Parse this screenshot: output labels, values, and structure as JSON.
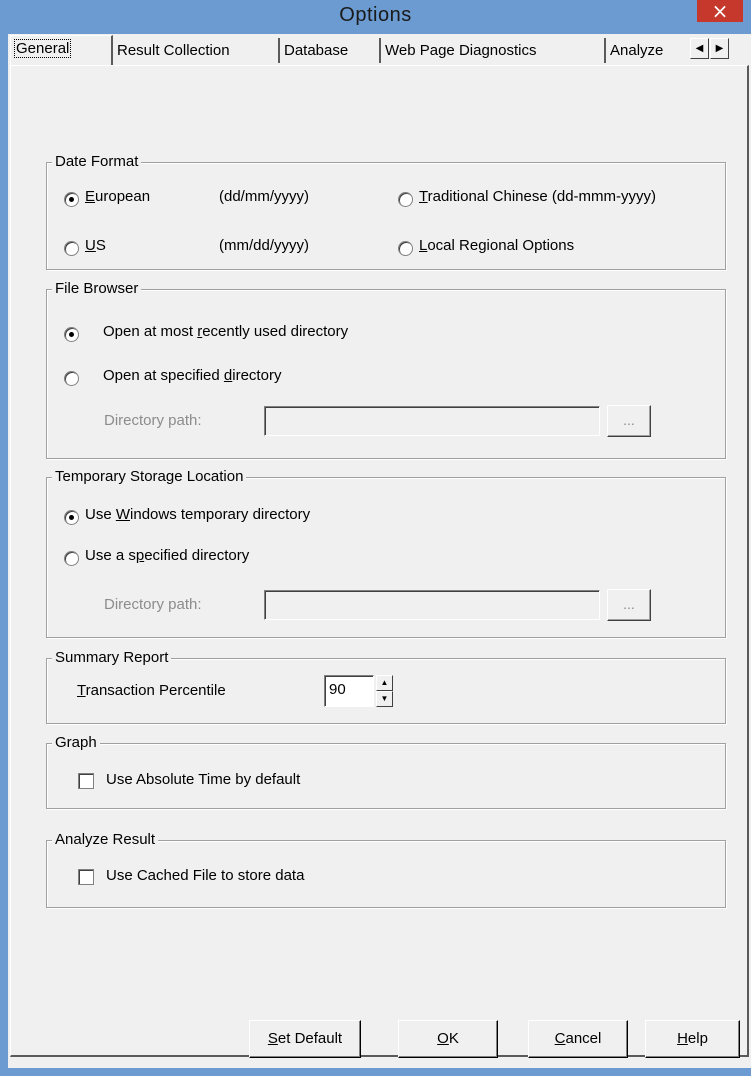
{
  "window": {
    "title": "Options",
    "close_label": "×"
  },
  "tabs": [
    {
      "label": "General",
      "active": true
    },
    {
      "label": "Result Collection",
      "active": false
    },
    {
      "label": "Database",
      "active": false
    },
    {
      "label": "Web Page Diagnostics",
      "active": false
    },
    {
      "label": "Analyze",
      "active": false
    }
  ],
  "tab_scroll": {
    "left_icon": "◀",
    "right_icon": "▶"
  },
  "date_format": {
    "legend": "Date Format",
    "options": [
      {
        "label_u": "E",
        "label_rest": "uropean",
        "format": "(dd/mm/yyyy)",
        "selected": true
      },
      {
        "label_u": "U",
        "label_rest": "S",
        "format": "(mm/dd/yyyy)",
        "selected": false
      },
      {
        "label_u": "T",
        "label_rest": "raditional Chinese (dd-mmm-yyyy)",
        "selected": false
      },
      {
        "label_u": "L",
        "label_rest": "ocal Regional Options",
        "selected": false
      }
    ]
  },
  "file_browser": {
    "legend": "File Browser",
    "option1": {
      "pre": "Open at most ",
      "u": "r",
      "post": "ecently used directory",
      "selected": true
    },
    "option2": {
      "pre": "Open at specified ",
      "u": "d",
      "post": "irectory",
      "selected": false
    },
    "path_label": "Directory  path:",
    "path_value": "",
    "browse_label": "..."
  },
  "temp_storage": {
    "legend": "Temporary Storage Location",
    "option1": {
      "pre": "Use ",
      "u": "W",
      "post": "indows temporary directory",
      "selected": true
    },
    "option2": {
      "pre": "Use a s",
      "u": "p",
      "post": "ecified directory",
      "selected": false
    },
    "path_label": "Directory  path:",
    "path_value": "",
    "browse_label": "..."
  },
  "summary_report": {
    "legend": "Summary Report",
    "label_u": "T",
    "label_rest": "ransaction Percentile",
    "value": "90",
    "up_icon": "▲",
    "down_icon": "▼"
  },
  "graph": {
    "legend": "Graph",
    "checkbox_label": "Use Absolute Time by default",
    "checked": false
  },
  "analyze_result": {
    "legend": "Analyze Result",
    "checkbox_label": "Use Cached File to store data",
    "checked": false
  },
  "buttons": {
    "set_default": {
      "u": "S",
      "rest": "et Default"
    },
    "ok": {
      "u": "O",
      "rest": "K"
    },
    "cancel": {
      "u": "C",
      "rest": "ancel"
    },
    "help": {
      "u": "H",
      "rest": "elp"
    }
  }
}
